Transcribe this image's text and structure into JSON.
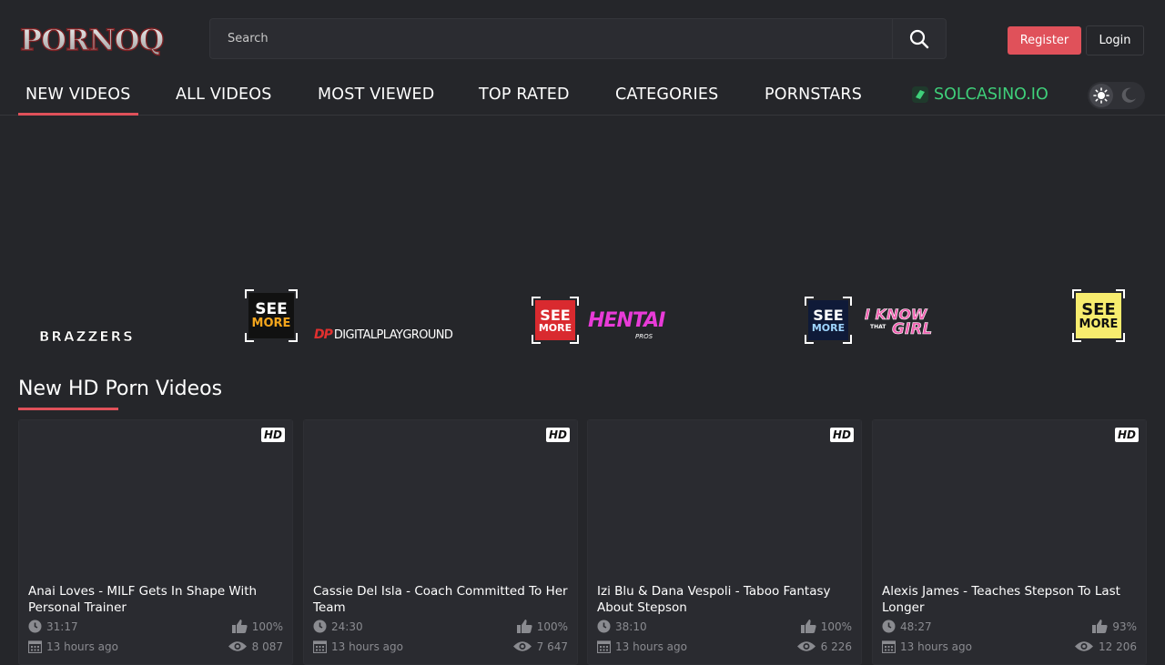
{
  "header": {
    "logo_text": "PORNOQ",
    "search_placeholder": "Search",
    "register_label": "Register",
    "login_label": "Login"
  },
  "nav": {
    "items": [
      {
        "label": "NEW VIDEOS",
        "active": true
      },
      {
        "label": "ALL VIDEOS"
      },
      {
        "label": "MOST VIEWED"
      },
      {
        "label": "TOP RATED"
      },
      {
        "label": "CATEGORIES"
      },
      {
        "label": "PORNSTARS"
      }
    ],
    "casino_label": "SOLCASINO.IO",
    "casino_color": "#3fd07a"
  },
  "theme_toggle": {
    "sun_icon": "sun-icon",
    "moon_icon": "moon-icon"
  },
  "sponsors": [
    {
      "name": "BRAZZERS"
    },
    {
      "see_more_l1": "SEE",
      "see_more_l2": "MORE"
    },
    {
      "name": "DIGITALPLAYGROUND",
      "prefix": "DP"
    },
    {
      "see_more_l1": "SEE",
      "see_more_l2": "MORE"
    },
    {
      "name": "HENTAI",
      "sub": "PROS"
    },
    {
      "see_more_l1": "SEE",
      "see_more_l2": "MORE"
    },
    {
      "name_l1": "I KNOW",
      "name_mid": "THAT",
      "name_l2": "GIRL"
    },
    {
      "see_more_l1": "SEE",
      "see_more_l2": "MORE"
    }
  ],
  "section": {
    "title": "New HD Porn Videos"
  },
  "videos": [
    {
      "badge": "HD",
      "title": "Anai Loves - MILF Gets In Shape With Personal Trainer",
      "duration": "31:17",
      "rating": "100%",
      "date": "13 hours ago",
      "views": "8 087"
    },
    {
      "badge": "HD",
      "title": "Cassie Del Isla - Coach Committed To Her Team",
      "duration": "24:30",
      "rating": "100%",
      "date": "13 hours ago",
      "views": "7 647"
    },
    {
      "badge": "HD",
      "title": "Izi Blu & Dana Vespoli - Taboo Fantasy About Stepson",
      "duration": "38:10",
      "rating": "100%",
      "date": "13 hours ago",
      "views": "6 226"
    },
    {
      "badge": "HD",
      "title": "Alexis James - Teaches Stepson To Last Longer",
      "duration": "48:27",
      "rating": "93%",
      "date": "13 hours ago",
      "views": "12 206"
    }
  ],
  "colors": {
    "accent": "#e0515a",
    "background": "#25262a",
    "card": "#2a2b30"
  }
}
